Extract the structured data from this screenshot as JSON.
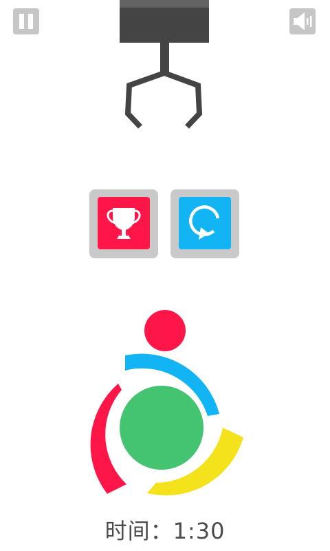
{
  "controls": {
    "pause_icon": "pause-icon",
    "sound_icon": "speaker-icon"
  },
  "menu": {
    "leaderboard_icon": "trophy-icon",
    "restart_icon": "restart-icon",
    "leaderboard_color": "#ff1648",
    "restart_color": "#12b4f4"
  },
  "game": {
    "ball_colors": {
      "red": "#ff1648",
      "blue": "#12b4f4",
      "yellow": "#f4e21c",
      "green": "#44c371"
    }
  },
  "timer": {
    "label": "时间：",
    "value": "1:30"
  }
}
